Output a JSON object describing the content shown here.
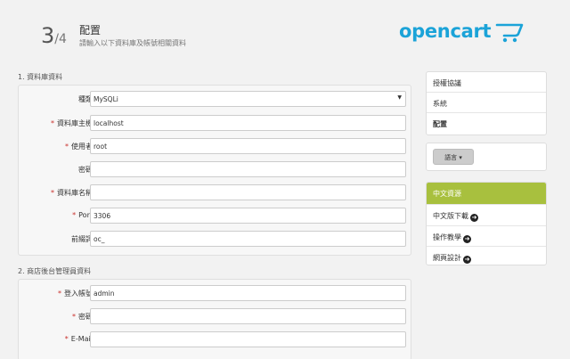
{
  "header": {
    "step_number": "3",
    "step_total": "/4",
    "title": "配置",
    "subtitle": "請輸入以下資料庫及帳號相關資料",
    "logo_text": "opencart",
    "logo_icon": "cart-icon",
    "logo_color": "#1ba3d8"
  },
  "db_section": {
    "heading": "1. 資料庫資料",
    "fields": [
      {
        "label": "種類",
        "required": false,
        "value": "MySQLi",
        "type": "select"
      },
      {
        "label": "資料庫主機",
        "required": true,
        "value": "localhost"
      },
      {
        "label": "使用者",
        "required": true,
        "value": "root"
      },
      {
        "label": "密碼",
        "required": false,
        "value": ""
      },
      {
        "label": "資料庫名稱",
        "required": true,
        "value": ""
      },
      {
        "label": "Port",
        "required": true,
        "value": "3306"
      },
      {
        "label": "前綴詞",
        "required": false,
        "value": "oc_"
      }
    ]
  },
  "admin_section": {
    "heading": "2. 商店後台管理員資料",
    "fields": [
      {
        "label": "登入帳號",
        "required": true,
        "value": "admin"
      },
      {
        "label": "密碼",
        "required": true,
        "value": ""
      },
      {
        "label": "E-Mail",
        "required": true,
        "value": ""
      }
    ]
  },
  "sidebar": {
    "steps": [
      "授權協議",
      "系統",
      "配置"
    ],
    "active_step": "配置",
    "language_button": "語言",
    "links_heading": "中文資源",
    "links": [
      "中文版下載",
      "操作教學",
      "網頁設計"
    ],
    "accent_color": "#a8c03e",
    "required_color": "#c9302c"
  }
}
